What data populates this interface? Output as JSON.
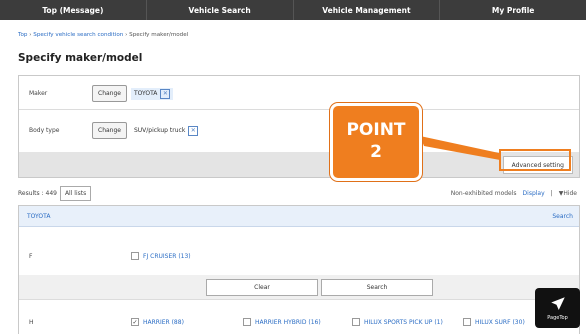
{
  "nav": {
    "items": [
      "Top (Message)",
      "Vehicle Search",
      "Vehicle Management",
      "My Profile"
    ]
  },
  "breadcrumb": {
    "top": "Top",
    "sep1": "›",
    "step1": "Specify vehicle search condition",
    "sep2": "›",
    "current": "Specify maker/model"
  },
  "page_title": "Specify maker/model",
  "conditions": {
    "maker_label": "Maker",
    "maker_change": "Change",
    "maker_value": "TOYOTA",
    "body_label": "Body type",
    "body_change": "Change",
    "body_value": "SUV/pickup truck",
    "remove_glyph": "✕",
    "advanced_setting": "Advanced setting"
  },
  "callout": {
    "line1": "POINT",
    "line2": "2",
    "color": "#ef7e1f"
  },
  "results": {
    "label": "Results : 449",
    "all_lists": "All lists",
    "non_exhibited": "Non-exhibited models",
    "display": "Display",
    "sep": "|",
    "hide": "▼Hide"
  },
  "list": {
    "group_label": "TOYOTA",
    "search_link": "Search",
    "section_f": "F",
    "f_items": [
      "FJ CRUISER (13)"
    ],
    "clear": "Clear",
    "search": "Search",
    "section_h": "H",
    "h_items": [
      "HARRIER (88)",
      "HARRIER HYBRID (16)",
      "HILUX SPORTS PICK UP (1)",
      "HILUX SURF (30)"
    ],
    "check_glyph": "✓"
  },
  "pagetop": {
    "label": "PageTop"
  }
}
